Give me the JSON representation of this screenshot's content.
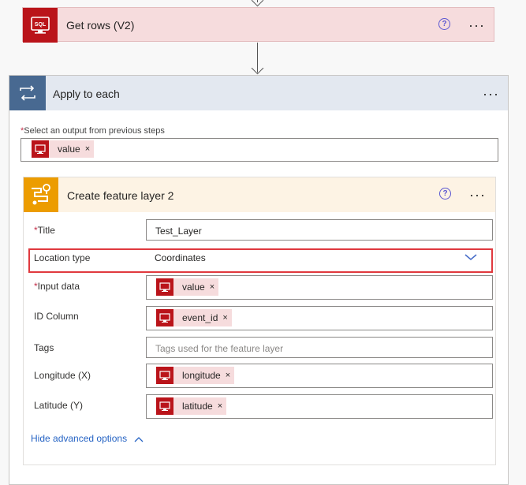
{
  "get_rows": {
    "title": "Get rows (V2)",
    "icon_text": "SQL",
    "help_icon": "?",
    "more": "···"
  },
  "apply_each": {
    "title": "Apply to each",
    "more": "···",
    "select_label": "Select an output from previous steps",
    "required_mark": "*",
    "token": {
      "label": "value",
      "remove": "×"
    }
  },
  "feature_layer": {
    "title": "Create feature layer 2",
    "help_icon": "?",
    "more": "···",
    "fields": {
      "title": {
        "label": "Title",
        "value": "Test_Layer"
      },
      "location_type": {
        "label": "Location type",
        "value": "Coordinates"
      },
      "input_data": {
        "label": "Input data",
        "token": "value"
      },
      "id_column": {
        "label": "ID Column",
        "token": "event_id"
      },
      "tags": {
        "label": "Tags",
        "placeholder": "Tags used for the feature layer"
      },
      "longitude": {
        "label": "Longitude (X)",
        "token": "longitude"
      },
      "latitude": {
        "label": "Latitude (Y)",
        "token": "latitude"
      }
    },
    "remove": "×",
    "advanced_link": "Hide advanced options"
  },
  "colors": {
    "sql_red": "#ba141a",
    "token_bg": "#f6dcdd",
    "loop_blue": "#486991",
    "map_orange": "#ec9c00",
    "highlight_red": "#e0393e",
    "link_blue": "#2563c4"
  }
}
